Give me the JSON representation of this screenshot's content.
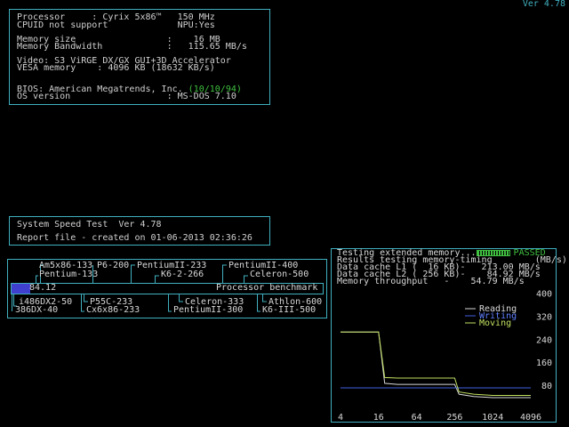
{
  "version": "Ver 4.78",
  "sysinfo": {
    "processor": "Processor     : Cyrix 5x86™   150 MHz",
    "cpuid": "CPUID not support             NPU:Yes",
    "memory_size": "Memory size                 :    16 MB",
    "memory_bandwidth": "Memory Bandwidth            :   115.65 MB/s",
    "video": "Video: S3 ViRGE DX/GX GUI+3D Accelerator",
    "vesa": "VESA memory    : 4096 KB (18632 KB/s)",
    "bios_label": "BIOS: American Megatrends, Inc.",
    "bios_date": "(10/10/94)",
    "os": "OS version                  : MS-DOS 7.10"
  },
  "speedtest": {
    "title": "System Speed Test  Ver 4.78",
    "report": "Report file - created on 01-06-2013 02:36:26"
  },
  "benchmark": {
    "score": "84.12",
    "score_value": 84.12,
    "max_value": 800,
    "label": "Processor benchmark",
    "top_refs": [
      "Am5x86-133",
      "P6-200",
      "PentiumII-233",
      "PentiumII-400",
      "Pentium-133",
      "K6-2-266",
      "Celeron-500"
    ],
    "bottom_refs": [
      "i486DX2-50",
      "P55C-233",
      "Celeron-333",
      "Athlon-600",
      "386DX-40",
      "Cx6x86-233",
      "PentiumII-300",
      "K6-III-500"
    ]
  },
  "memtest": {
    "status_prefix": "Testing extended memory...",
    "status_result": "PASSED",
    "results_line": "Results testing memory-timing        (MB/s)",
    "l1": "Data cache L1 (  16 KB)-   213.00 MB/s",
    "l2": "Data cache L2 ( 256 KB)-    84.92 MB/s",
    "throughput": "Memory throughput   -    54.79 MB/s"
  },
  "chart_data": {
    "type": "line",
    "title": "Results testing memory-timing",
    "ylabel": "(MB/s)",
    "xscale": "log2",
    "x_ticks": [
      4,
      16,
      64,
      256,
      1024,
      4096
    ],
    "y_ticks": [
      80,
      160,
      240,
      320,
      400
    ],
    "xlim": [
      4,
      4096
    ],
    "ylim": [
      0,
      420
    ],
    "legend": [
      "Reading",
      "Writing",
      "Moving"
    ],
    "legend_position": "top-right",
    "series": [
      {
        "name": "Reading",
        "color": "#d8d8d8",
        "x": [
          4,
          8,
          12,
          16,
          20,
          32,
          64,
          128,
          256,
          300,
          512,
          1024,
          2048,
          4096
        ],
        "y": [
          268,
          268,
          268,
          268,
          90,
          86,
          86,
          86,
          86,
          52,
          44,
          40,
          40,
          40
        ]
      },
      {
        "name": "Writing",
        "color": "#4060e0",
        "x": [
          4,
          16,
          64,
          256,
          1024,
          4096
        ],
        "y": [
          74,
          74,
          74,
          74,
          74,
          74
        ]
      },
      {
        "name": "Moving",
        "color": "#c0e060",
        "x": [
          4,
          8,
          12,
          16,
          20,
          32,
          64,
          128,
          256,
          300,
          512,
          1024,
          2048,
          4096
        ],
        "y": [
          268,
          268,
          268,
          268,
          110,
          108,
          108,
          108,
          108,
          60,
          52,
          48,
          48,
          48
        ]
      }
    ]
  }
}
